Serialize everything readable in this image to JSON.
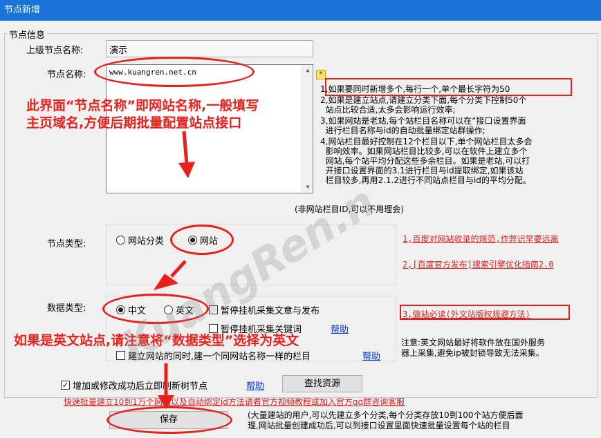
{
  "window": {
    "title": "节点新增"
  },
  "group": {
    "title": "节点信息"
  },
  "parent_node": {
    "label": "上级节点名称:",
    "value": "演示"
  },
  "node_name": {
    "label": "节点名称:",
    "value": "www.kuangren.net.cn"
  },
  "tips": {
    "line1": "1,如果要同时新增多个,每行一个,单个最长字符为50",
    "line2": "2,如果是建立站点,请建立分类下面,每个分类下控制50个\n  站点比较合适,太多会影响运行效率;",
    "line3": "3,如果网站是老站,每个站栏目名称可以在“接口设置界面\n  进行栏目名称与id的自动批量绑定站群操作;",
    "line4": "4,网站栏目最好控制在12个栏目以下,单个网站栏目太多会\n  影响效率。如果网站栏目比较多,可以在软件上建立多个\n  网站,每个站平均分配这些多余栏目。如果是老站,可以打\n  开接口设置界面的3.1进行栏目与id提取绑定,如果该站\n  栏目较多,再用2.1.2进行不同站点栏目与id的平均分配。"
  },
  "column_id_note": "(非网站栏目ID,可以不用理会)",
  "node_type": {
    "label": "节点类型:",
    "options": [
      "网站分类",
      "网站"
    ],
    "selected": "网站"
  },
  "data_type": {
    "label": "数据类型:",
    "options": [
      "中文",
      "英文"
    ],
    "selected": "中文",
    "checkbox_pause_publish": "暂停挂机采集文章与发布",
    "checkbox_pause_keywords": "暂停挂机采集关键词",
    "help": "帮助",
    "checkbox_create_column": "建立网站的同时,建一个同网站名称一样的栏目",
    "help2": "帮助"
  },
  "right_links": {
    "link1": "1,百度对网站收录的规范,作弊识早要远离",
    "link2": "2,[百度官方发布]搜索引擎优化指南2.0",
    "link3": "3,做站必读(外文站版权规避方法)"
  },
  "english_note": "注意:英文网站最好将软件放在国外服务\n器上采集,避免ip被封锁导致无法采集。",
  "refresh": {
    "label": "增加或修改成功后立即刷新树节点",
    "checked": true,
    "help": "帮助"
  },
  "find_resource_button": "查找资源",
  "bulk_link": "快速批量建立10到1万个网站以及自动绑定id方法请看官方视频教程或加入官方qq群咨询客服",
  "save_button": "保存",
  "bottom_note": "(大量建站的用户,可以先建立多个分类,每个分类存放10到100个站方便后面\n理,网站批量创建成功后,可以到接口设置里面快速批量设置每个站的栏目",
  "annotations": {
    "node_name_explain_1": "此界面“节点名称”即网站名称,一般填写",
    "node_name_explain_2": "主页域名,方便后期批量配置站点接口",
    "english_site": "如果是英文站点,请注意将“数据类型”选择为英文"
  },
  "watermark": "KuangRen.n",
  "colors": {
    "titlebar": "#1a73d9",
    "annotation": "#e8201c",
    "link": "#0033cc"
  }
}
